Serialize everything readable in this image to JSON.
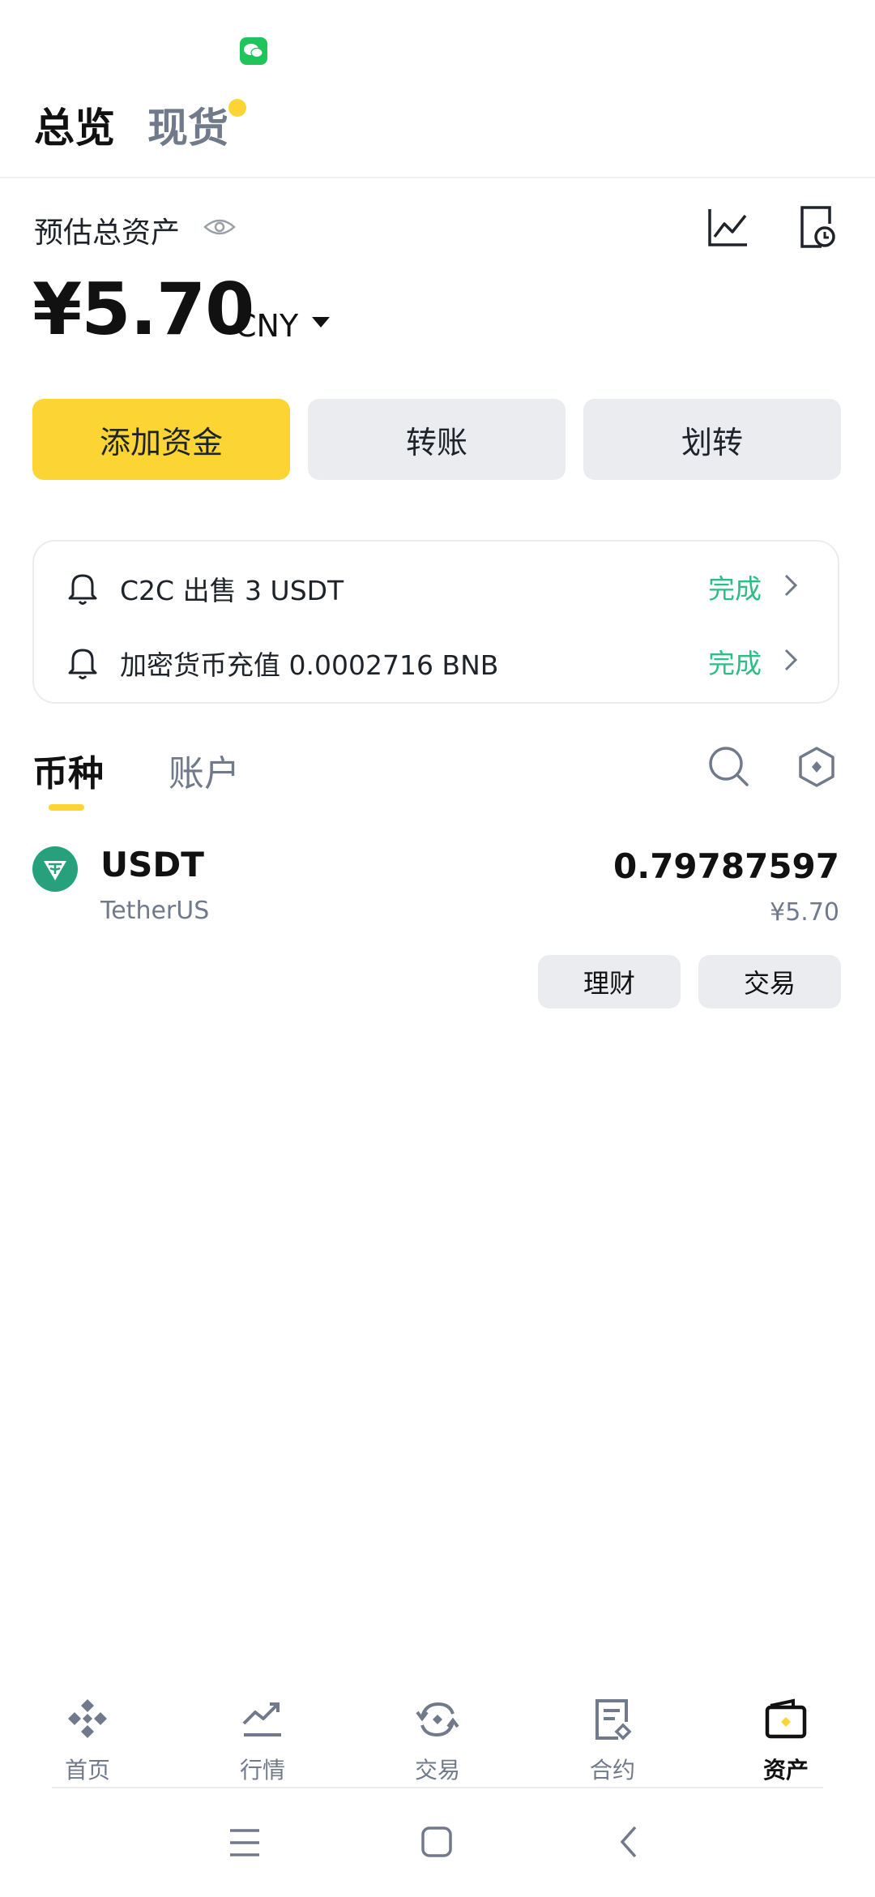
{
  "header": {
    "tabs": [
      "总览",
      "现货"
    ]
  },
  "summary": {
    "label": "预估总资产",
    "balance": "¥5.70",
    "currency": "CNY"
  },
  "actions": {
    "add_funds": "添加资金",
    "transfer": "转账",
    "internal_transfer": "划转"
  },
  "notices": [
    {
      "text": "C2C 出售 3 USDT",
      "status": "完成"
    },
    {
      "text": "加密货币充值 0.0002716 BNB",
      "status": "完成"
    }
  ],
  "section_tabs": [
    "币种",
    "账户"
  ],
  "coins": [
    {
      "symbol": "USDT",
      "name": "TetherUS",
      "amount": "0.79787597",
      "value": "¥5.70",
      "buttons": {
        "earn": "理财",
        "trade": "交易"
      }
    }
  ],
  "bottom_nav": [
    {
      "label": "首页",
      "icon": "home-icon"
    },
    {
      "label": "行情",
      "icon": "markets-icon"
    },
    {
      "label": "交易",
      "icon": "trade-icon"
    },
    {
      "label": "合约",
      "icon": "futures-icon"
    },
    {
      "label": "资产",
      "icon": "wallet-icon"
    }
  ],
  "colors": {
    "accent": "#fcd535",
    "success": "#2ebd85",
    "usdt": "#26a17b"
  }
}
